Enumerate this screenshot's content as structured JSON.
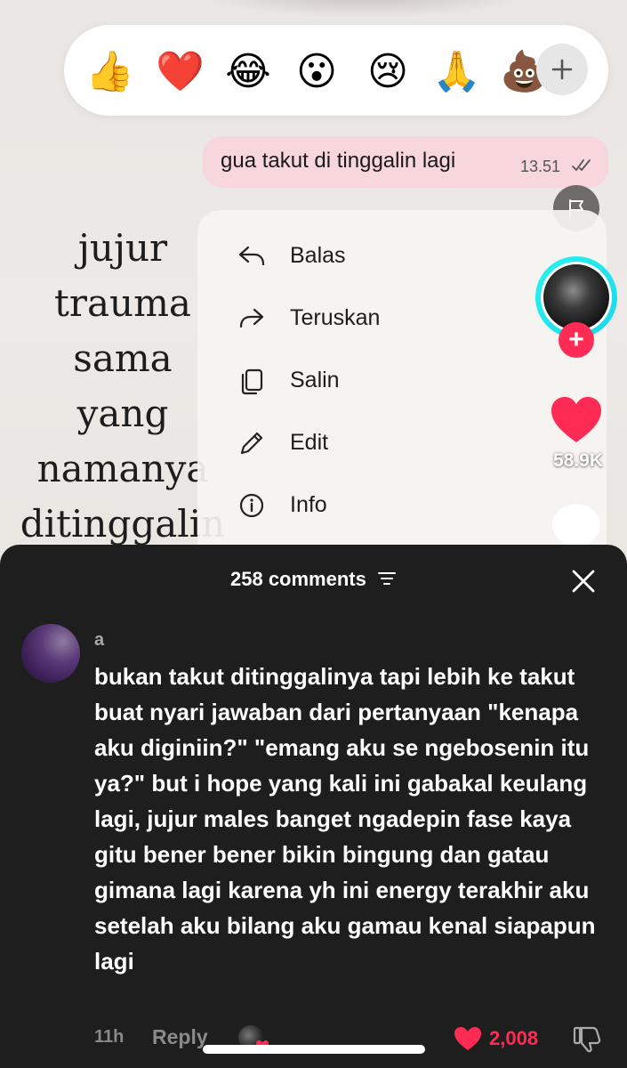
{
  "reactions": {
    "emojis": [
      "👍",
      "❤️",
      "😂",
      "😮",
      "😢",
      "🙏",
      "💩"
    ],
    "more_icon": "plus-icon"
  },
  "message": {
    "text": "gua takut di tinggalin lagi",
    "time": "13.51",
    "status_icon": "double-check-icon",
    "bubble_color": "#f7d6dc"
  },
  "poem": {
    "lines": [
      "jujur",
      "trauma",
      "sama",
      "yang",
      "namanya",
      "ditinggalin"
    ]
  },
  "context_menu": {
    "items": [
      {
        "label": "Balas",
        "icon": "reply-icon"
      },
      {
        "label": "Teruskan",
        "icon": "forward-icon"
      },
      {
        "label": "Salin",
        "icon": "copy-icon"
      },
      {
        "label": "Edit",
        "icon": "pencil-icon"
      },
      {
        "label": "Info",
        "icon": "info-icon"
      }
    ]
  },
  "side_rail": {
    "like_count": "58.9K",
    "accent_color": "#fe2c55"
  },
  "comments": {
    "title": "258 comments",
    "comment": {
      "username": "a",
      "text": "bukan takut ditinggalinya tapi lebih ke takut buat nyari jawaban dari pertanyaan \"kenapa aku diginiin?\" \"emang aku se ngebosenin itu ya?\" but i hope yang kali ini gabakal keulang lagi, jujur males banget ngadepin fase kaya gitu bener bener bikin bingung dan gatau gimana lagi karena yh ini energy terakhir aku setelah aku bilang aku gamau kenal siapapun lagi",
      "time": "11h",
      "reply_label": "Reply",
      "likes": "2,008"
    }
  }
}
